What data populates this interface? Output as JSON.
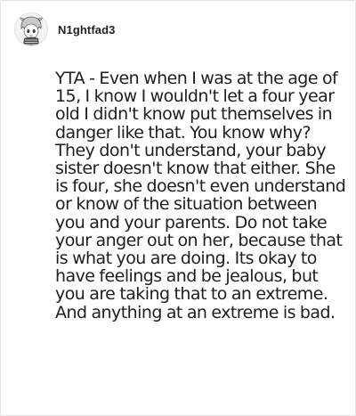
{
  "post": {
    "username": "N1ghtfad3",
    "avatar_icon": "anime-character-avatar-icon",
    "comment": "YTA - Even when I was at the age of 15, I know I wouldn't let a four year old I didn't know put themselves in danger like that. You know why? They don't understand, your baby sister doesn't know that either. She is four, she doesn't even understand or know of the situation between you and your parents. Do not take your anger out on her, because that is what you are doing. Its okay to have feelings and be jealous, but you are taking that to an extreme. And anything at an extreme is bad."
  }
}
